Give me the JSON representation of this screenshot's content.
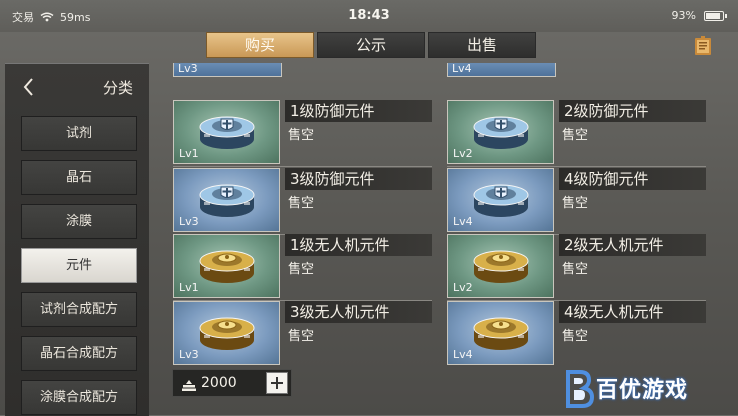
{
  "status_bar": {
    "carrier": "交易",
    "ping": "59ms",
    "time": "18:43",
    "battery": "93%",
    "battery_fraction": 0.93
  },
  "tabs": [
    {
      "label": "购买",
      "active": true
    },
    {
      "label": "公示",
      "active": false
    },
    {
      "label": "出售",
      "active": false
    }
  ],
  "sidebar": {
    "title": "分类",
    "items": [
      {
        "label": "试剂",
        "active": false
      },
      {
        "label": "晶石",
        "active": false
      },
      {
        "label": "涂膜",
        "active": false
      },
      {
        "label": "元件",
        "active": true
      },
      {
        "label": "试剂合成配方",
        "active": false
      },
      {
        "label": "晶石合成配方",
        "active": false
      },
      {
        "label": "涂膜合成配方",
        "active": false
      }
    ]
  },
  "partial_top": [
    {
      "lv": "Lv3"
    },
    {
      "lv": "Lv4"
    }
  ],
  "items": [
    {
      "name": "1级防御元件",
      "status": "售空",
      "lv": "Lv1",
      "bg": "green",
      "kind": "defense"
    },
    {
      "name": "2级防御元件",
      "status": "售空",
      "lv": "Lv2",
      "bg": "green",
      "kind": "defense"
    },
    {
      "name": "3级防御元件",
      "status": "售空",
      "lv": "Lv3",
      "bg": "blue",
      "kind": "defense"
    },
    {
      "name": "4级防御元件",
      "status": "售空",
      "lv": "Lv4",
      "bg": "blue",
      "kind": "defense"
    },
    {
      "name": "1级无人机元件",
      "status": "售空",
      "lv": "Lv1",
      "bg": "green",
      "kind": "drone"
    },
    {
      "name": "2级无人机元件",
      "status": "售空",
      "lv": "Lv2",
      "bg": "green",
      "kind": "drone"
    },
    {
      "name": "3级无人机元件",
      "status": "售空",
      "lv": "Lv3",
      "bg": "blue",
      "kind": "drone"
    },
    {
      "name": "4级无人机元件",
      "status": "售空",
      "lv": "Lv4",
      "bg": "blue",
      "kind": "drone"
    }
  ],
  "wallet": {
    "amount": "2000",
    "icon": "coin-stack-icon"
  },
  "watermark": {
    "text": "百优游戏",
    "logo": "b-logo-icon"
  },
  "colors": {
    "tab_active": "#d8ae6e",
    "defense_tint": "#9fc7e6",
    "drone_tint": "#d8b04a"
  }
}
